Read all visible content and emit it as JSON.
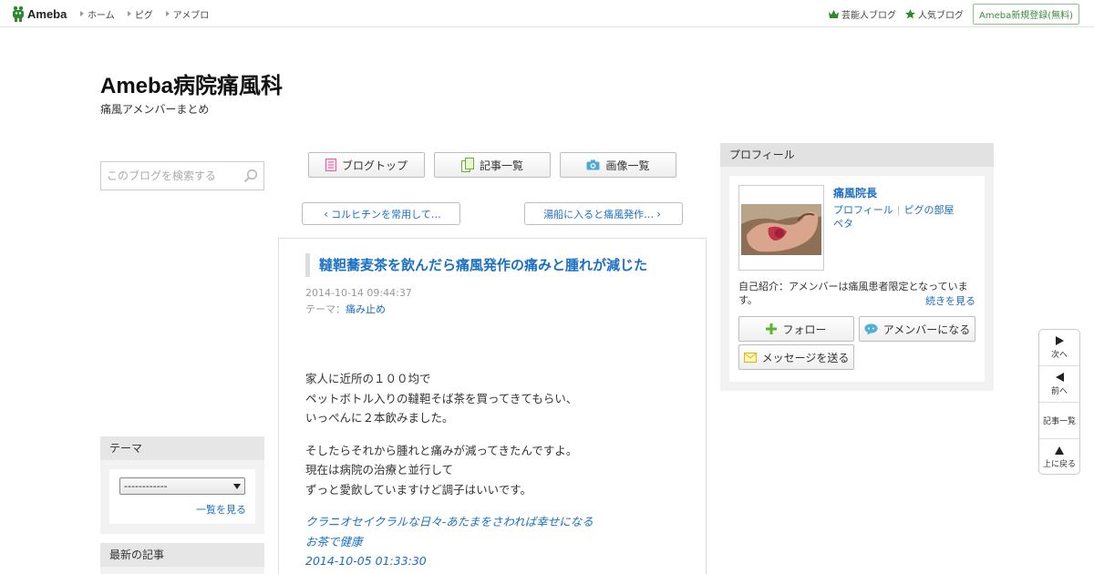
{
  "topbar": {
    "logo_text": "Ameba",
    "nav": [
      "ホーム",
      "ピグ",
      "アメブロ"
    ],
    "right_links": [
      "芸能人ブログ",
      "人気ブログ"
    ],
    "signup": "Ameba新規登録(無料)"
  },
  "blog": {
    "title": "Ameba病院痛風科",
    "description": "痛風アメンバーまとめ"
  },
  "search": {
    "placeholder": "このブログを検索する"
  },
  "theme_box": {
    "heading": "テーマ",
    "select_value": "------------",
    "more": "一覧を見る"
  },
  "recent_box": {
    "heading": "最新の記事"
  },
  "center_nav": {
    "blog_top": "ブログトップ",
    "article_list": "記事一覧",
    "image_list": "画像一覧",
    "prev": "コルヒチンを常用して…",
    "next": "湯船に入ると痛風発作…"
  },
  "article": {
    "title": "韃靼蕎麦茶を飲んだら痛風発作の痛みと腫れが減じた",
    "date": "2014-10-14 09:44:37",
    "theme_label": "テーマ：",
    "theme": "痛み止め",
    "paragraphs": [
      [
        "家人に近所の１００均で",
        "ペットボトル入りの韃靼そば茶を買ってきてもらい、",
        "いっぺんに２本飲みました。"
      ],
      [
        "そしたらそれから腫れと痛みが減ってきたんですよ。",
        "現在は病院の治療と並行して",
        "ずっと愛飲していますけど調子はいいです。"
      ]
    ],
    "quote": [
      "クラニオセイクラルな日々-あたまをさわれば幸せになる",
      "お茶で健康",
      "2014-10-05 01:33:30"
    ]
  },
  "profile": {
    "heading": "プロフィール",
    "name": "痛風院長",
    "link_profile": "プロフィール",
    "link_room": "ピグの部屋",
    "link_peta": "ペタ",
    "intro": "自己紹介：アメンバーは痛風患者限定となっています。",
    "more": "続きを見る",
    "follow": "フォロー",
    "amember": "アメンバーになる",
    "message": "メッセージを送る"
  },
  "float_nav": {
    "next": "次へ",
    "prev": "前へ",
    "list": "記事一覧",
    "top": "上に戻る"
  },
  "colors": {
    "link": "#1a6fc4",
    "ameba_green": "#2d8a2d",
    "box_gray": "#f2f2f2"
  }
}
